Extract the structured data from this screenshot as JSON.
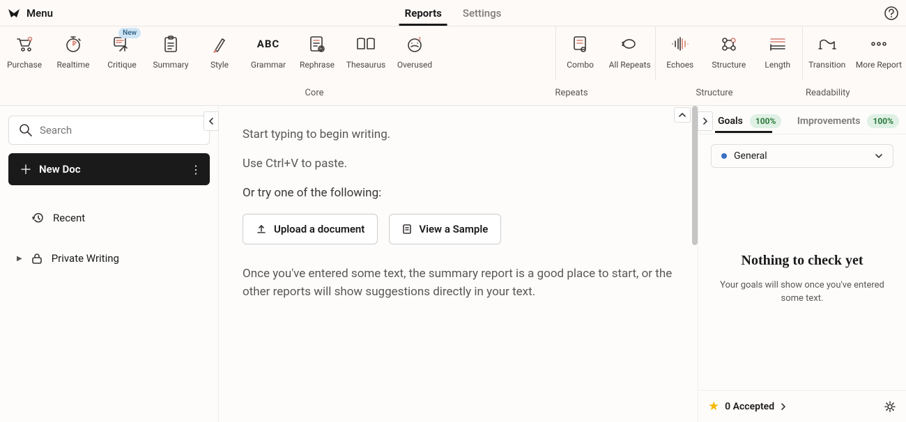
{
  "menu": {
    "label": "Menu"
  },
  "top_tabs": {
    "reports": "Reports",
    "settings": "Settings"
  },
  "toolbar": {
    "items": {
      "purchase": "Purchase",
      "realtime": "Realtime",
      "critique": "Critique",
      "summary": "Summary",
      "style": "Style",
      "grammar": "Grammar",
      "rephrase": "Rephrase",
      "thesaurus": "Thesaurus",
      "overused": "Overused",
      "combo": "Combo",
      "all_repeats": "All Repeats",
      "echoes": "Echoes",
      "structure": "Structure",
      "length": "Length",
      "transition": "Transition",
      "more_reports": "More Report"
    },
    "new_badge": "New",
    "groups": {
      "core": "Core",
      "repeats": "Repeats",
      "structure": "Structure",
      "readability": "Readability"
    }
  },
  "sidebar": {
    "search_placeholder": "Search",
    "new_doc": "New Doc",
    "recent": "Recent",
    "private_writing": "Private Writing"
  },
  "editor": {
    "line1": "Start typing to begin writing.",
    "line2": "Use Ctrl+V to paste.",
    "line3": "Or try one of the following:",
    "upload_btn": "Upload a document",
    "sample_btn": "View a Sample",
    "para": "Once you've entered some text, the summary report is a good place to start, or the other reports will show suggestions directly in your text."
  },
  "panel": {
    "goals_tab": "Goals",
    "goals_pct": "100%",
    "improvements_tab": "Improvements",
    "improvements_pct": "100%",
    "general": "General",
    "empty_title": "Nothing to check yet",
    "empty_sub": "Your goals will show once you've entered some text.",
    "accepted": "0 Accepted"
  }
}
